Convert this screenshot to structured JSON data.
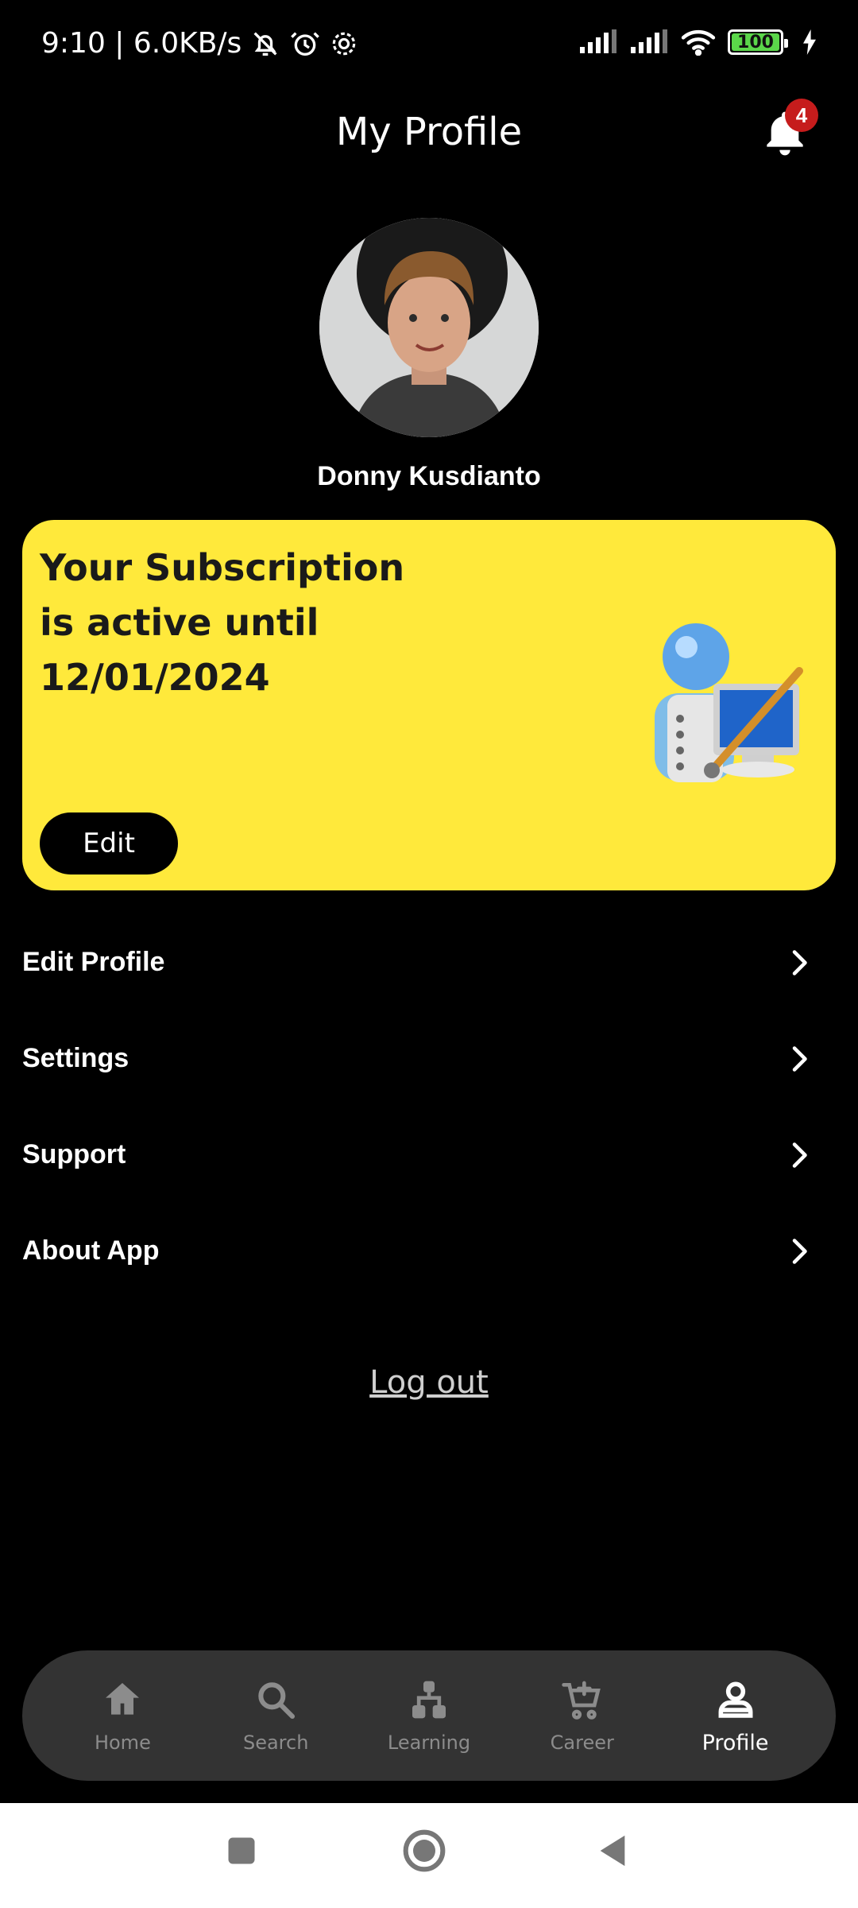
{
  "status_bar": {
    "time_speed": "9:10 | 6.0KB/s",
    "icons": [
      "bell-off-icon",
      "alarm-icon",
      "settings-icon"
    ],
    "right_icons": [
      "signal-icon",
      "signal-icon",
      "wifi-icon",
      "battery-icon",
      "charging-icon"
    ],
    "battery_level": "100"
  },
  "header": {
    "title": "My Profile",
    "notification_count": "4"
  },
  "profile": {
    "name": "Donny Kusdianto"
  },
  "subscription": {
    "line1": "Your Subscription",
    "line2": "is active until",
    "line3": "12/01/2024",
    "edit_label": "Edit",
    "card_color": "#ffe93b"
  },
  "menu": {
    "items": [
      {
        "label": "Edit Profile"
      },
      {
        "label": "Settings"
      },
      {
        "label": "Support"
      },
      {
        "label": "About App"
      }
    ]
  },
  "logout_label": "Log out",
  "bottom_nav": {
    "items": [
      {
        "label": "Home",
        "icon": "home-icon"
      },
      {
        "label": "Search",
        "icon": "search-icon"
      },
      {
        "label": "Learning",
        "icon": "hierarchy-icon"
      },
      {
        "label": "Career",
        "icon": "cart-add-icon"
      },
      {
        "label": "Profile",
        "icon": "person-icon"
      }
    ],
    "active": "Profile"
  },
  "colors": {
    "background": "#000000",
    "accent": "#ffe93b",
    "badge": "#c61c1c",
    "nav_bg": "#333333"
  }
}
